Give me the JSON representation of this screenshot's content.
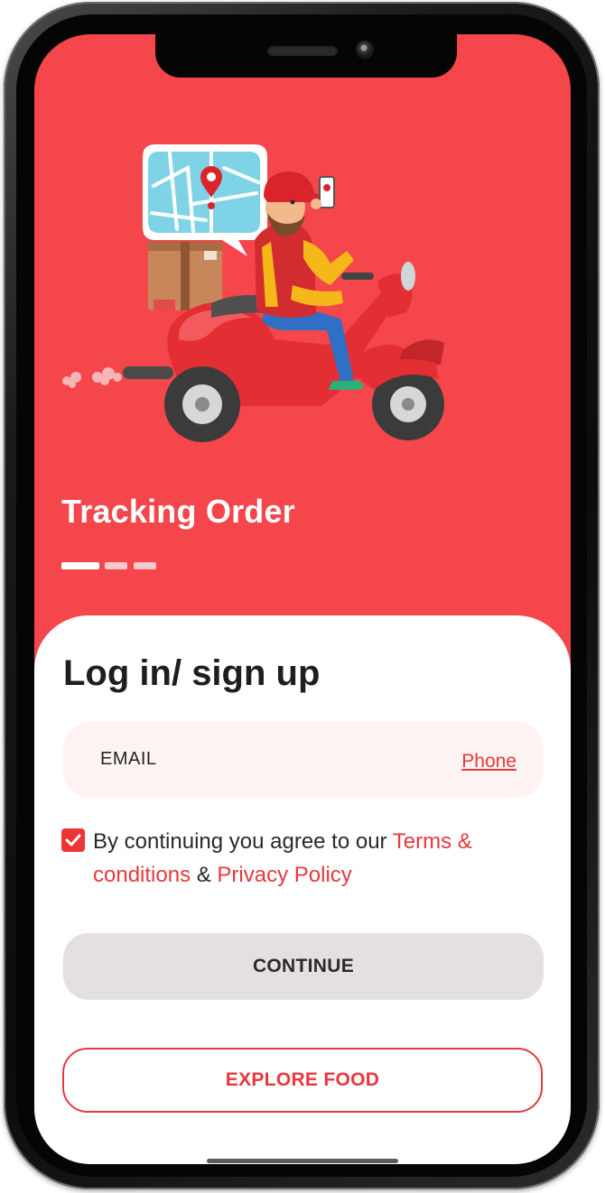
{
  "onboarding": {
    "title": "Tracking Order",
    "page_indicator": {
      "pages": 3,
      "active": 0
    },
    "illustration": "delivery-scooter-illustration"
  },
  "login": {
    "title": "Log in/ sign up",
    "field_label": "EMAIL",
    "switch_link": "Phone",
    "agree": {
      "checked": true,
      "prefix": "By continuing you agree to our ",
      "terms": "Terms & conditions",
      "joiner": " & ",
      "privacy": "Privacy Policy"
    },
    "continue_label": "CONTINUE",
    "explore_label": "EXPLORE FOOD"
  },
  "colors": {
    "brand_red": "#f4464b",
    "accent_red": "#e8383d",
    "continue_bg": "#e5e0e0",
    "field_bg": "#fdf3f2"
  },
  "icons": [
    "checkbox-checked-icon",
    "map-pin-icon",
    "delivery-scooter-illustration"
  ]
}
